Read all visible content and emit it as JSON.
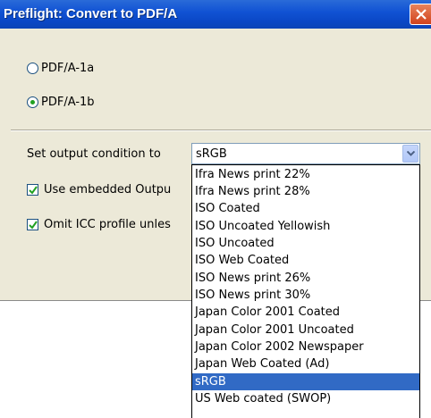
{
  "window": {
    "title": "Preflight: Convert to PDF/A"
  },
  "pdfa_options": [
    {
      "label": "PDF/A-1a",
      "checked": false
    },
    {
      "label": "PDF/A-1b",
      "checked": true
    }
  ],
  "output_condition": {
    "label": "Set output condition to",
    "selected_value": "sRGB",
    "options": [
      "Ifra News print 22%",
      "Ifra News print 28%",
      "ISO Coated",
      "ISO Uncoated Yellowish",
      "ISO Uncoated",
      "ISO Web Coated",
      "ISO News print 26%",
      "ISO News print 30%",
      "Japan Color 2001 Coated",
      "Japan Color 2001 Uncoated",
      "Japan Color 2002 Newspaper",
      "Japan Web Coated (Ad)",
      "sRGB",
      "US Web coated (SWOP)"
    ],
    "highlighted_option": "sRGB"
  },
  "checkboxes": [
    {
      "label": "Use embedded Outpu",
      "checked": true
    },
    {
      "label": "Omit ICC profile unles",
      "checked": true
    }
  ],
  "colors": {
    "selection": "#316ac5",
    "titlebar": "#0a47c6",
    "dialog_bg": "#ece9d8"
  }
}
